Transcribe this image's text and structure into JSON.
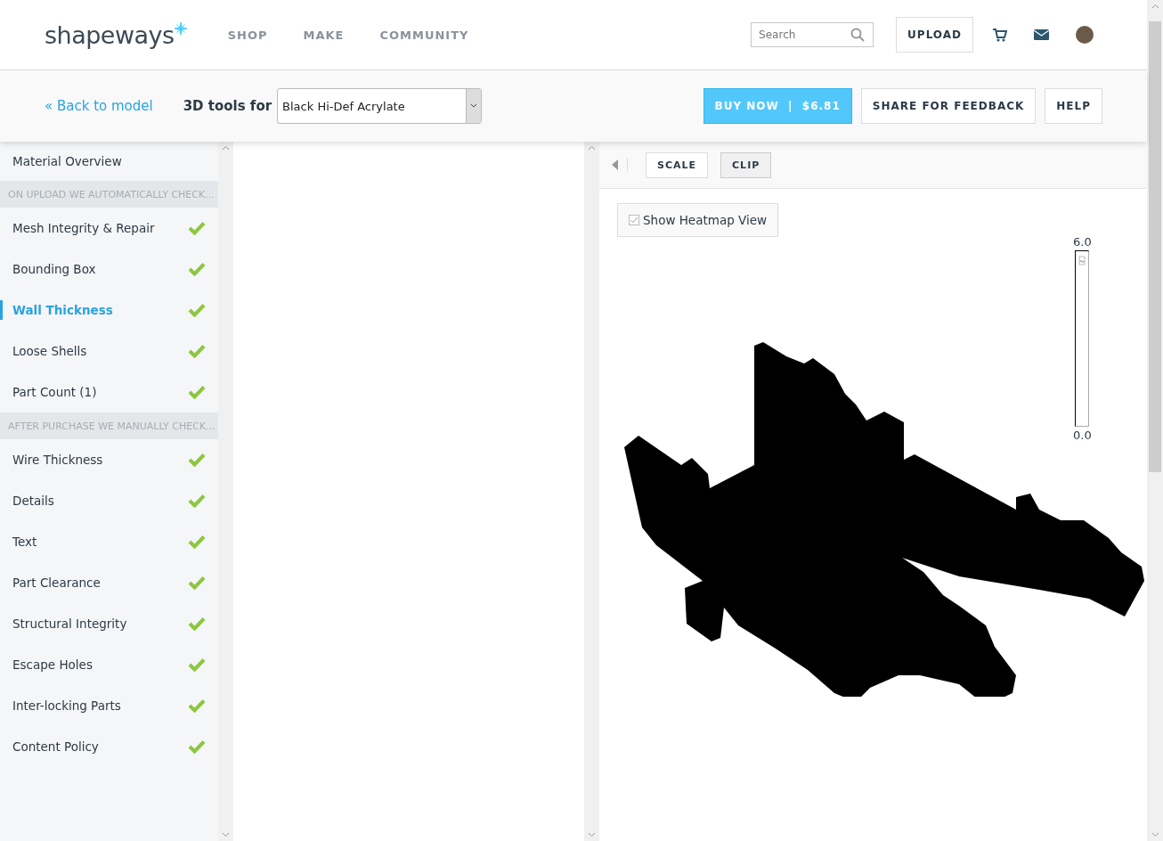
{
  "header": {
    "logo": "shapeways",
    "nav": [
      "SHOP",
      "MAKE",
      "COMMUNITY"
    ],
    "search": {
      "placeholder": "Search"
    },
    "upload_button": "UPLOAD"
  },
  "toolbar": {
    "back_link": "« Back to model",
    "tools_label": "3D tools for",
    "material": "Black Hi-Def Acrylate",
    "buy_button": "BUY NOW  |  $6.81",
    "share_button": "SHARE FOR FEEDBACK",
    "help_button": "HELP"
  },
  "sidebar": {
    "items": [
      {
        "kind": "link",
        "label": "Material Overview",
        "selected": false
      },
      {
        "kind": "section",
        "label": "ON UPLOAD WE AUTOMATICALLY CHECK..."
      },
      {
        "kind": "check",
        "label": "Mesh Integrity & Repair",
        "checked": true,
        "selected": false
      },
      {
        "kind": "check",
        "label": "Bounding Box",
        "checked": true,
        "selected": false
      },
      {
        "kind": "check",
        "label": "Wall Thickness",
        "checked": true,
        "selected": true
      },
      {
        "kind": "check",
        "label": "Loose Shells",
        "checked": true,
        "selected": false
      },
      {
        "kind": "check",
        "label": "Part Count (1)",
        "checked": true,
        "selected": false
      },
      {
        "kind": "section",
        "label": "AFTER PURCHASE WE MANUALLY CHECK..."
      },
      {
        "kind": "check",
        "label": "Wire Thickness",
        "checked": true,
        "selected": false
      },
      {
        "kind": "check",
        "label": "Details",
        "checked": true,
        "selected": false
      },
      {
        "kind": "check",
        "label": "Text",
        "checked": true,
        "selected": false
      },
      {
        "kind": "check",
        "label": "Part Clearance",
        "checked": true,
        "selected": false
      },
      {
        "kind": "check",
        "label": "Structural Integrity",
        "checked": true,
        "selected": false
      },
      {
        "kind": "check",
        "label": "Escape Holes",
        "checked": true,
        "selected": false
      },
      {
        "kind": "check",
        "label": "Inter-locking Parts",
        "checked": true,
        "selected": false
      },
      {
        "kind": "check",
        "label": "Content Policy",
        "checked": true,
        "selected": false
      }
    ]
  },
  "viewer": {
    "tools": [
      {
        "label": "SCALE",
        "selected": false
      },
      {
        "label": "CLIP",
        "selected": true
      }
    ],
    "heatmap_toggle": {
      "label": "Show Heatmap View",
      "checked": true
    },
    "legend": {
      "max": "6.0",
      "min": "0.0"
    }
  }
}
